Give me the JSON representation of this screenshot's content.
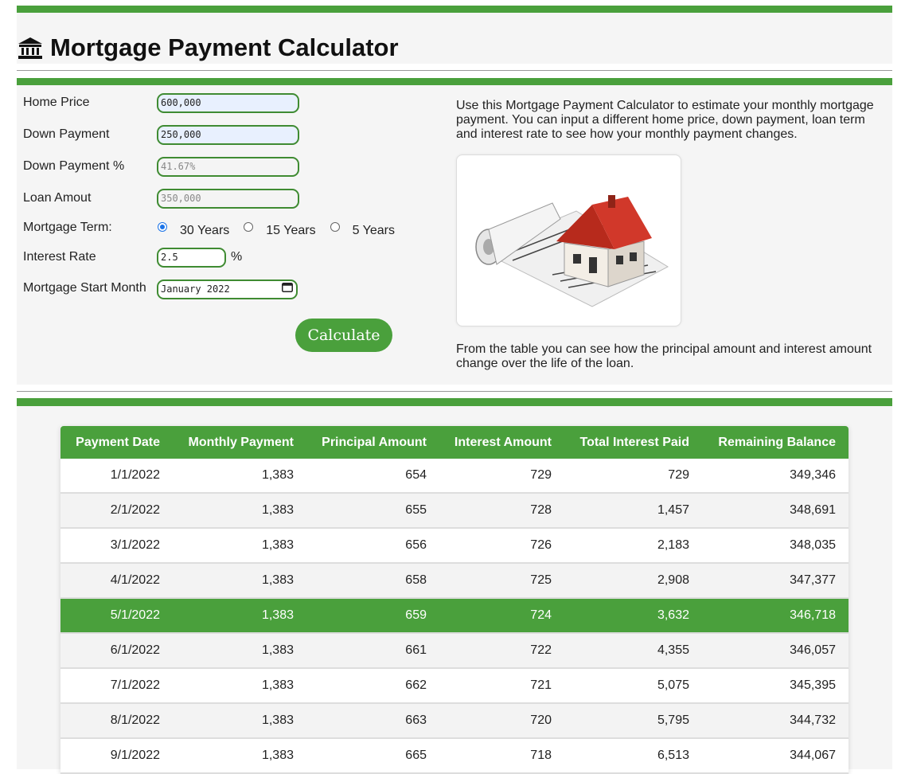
{
  "header": {
    "title": "Mortgage Payment Calculator",
    "icon": "bank-icon"
  },
  "form": {
    "home_price": {
      "label": "Home Price",
      "value": "600,000"
    },
    "down_payment": {
      "label": "Down Payment",
      "value": "250,000"
    },
    "down_payment_pct": {
      "label": "Down Payment %",
      "value": "41.67%"
    },
    "loan_amount": {
      "label": "Loan Amout",
      "value": "350,000"
    },
    "term": {
      "label": "Mortgage Term:",
      "options": [
        "30 Years",
        "15 Years",
        "5 Years"
      ],
      "selected": "30 Years"
    },
    "interest_rate": {
      "label": "Interest Rate",
      "value": "2.5",
      "unit": "%"
    },
    "start_month": {
      "label": "Mortgage Start Month",
      "value": "January 2022"
    },
    "calculate_label": "Calculate"
  },
  "info": {
    "intro": "Use this Mortgage Payment Calculator to estimate your monthly mortgage payment. You can input a different home price, down payment, loan term and interest rate to see how your monthly payment changes.",
    "image_name": "house-on-loan-application-image",
    "outro": "From the table you can see how the principal amount and interest amount change over the life of the loan."
  },
  "table": {
    "columns": [
      "Payment Date",
      "Monthly Payment",
      "Principal Amount",
      "Interest Amount",
      "Total Interest Paid",
      "Remaining Balance"
    ],
    "rows": [
      [
        "1/1/2022",
        "1,383",
        "654",
        "729",
        "729",
        "349,346"
      ],
      [
        "2/1/2022",
        "1,383",
        "655",
        "728",
        "1,457",
        "348,691"
      ],
      [
        "3/1/2022",
        "1,383",
        "656",
        "726",
        "2,183",
        "348,035"
      ],
      [
        "4/1/2022",
        "1,383",
        "658",
        "725",
        "2,908",
        "347,377"
      ],
      [
        "5/1/2022",
        "1,383",
        "659",
        "724",
        "3,632",
        "346,718"
      ],
      [
        "6/1/2022",
        "1,383",
        "661",
        "722",
        "4,355",
        "346,057"
      ],
      [
        "7/1/2022",
        "1,383",
        "662",
        "721",
        "5,075",
        "345,395"
      ],
      [
        "8/1/2022",
        "1,383",
        "663",
        "720",
        "5,795",
        "344,732"
      ],
      [
        "9/1/2022",
        "1,383",
        "665",
        "718",
        "6,513",
        "344,067"
      ]
    ],
    "highlighted_row": 4
  },
  "colors": {
    "accent": "#4aa03c",
    "input_border": "#3f8b32",
    "band": "#f5f5f5"
  }
}
